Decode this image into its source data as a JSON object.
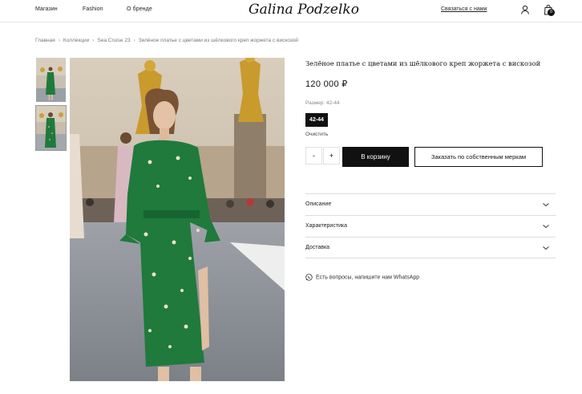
{
  "header": {
    "nav": [
      "Магазин",
      "Fashion",
      "О бренде"
    ],
    "logo": "Galina Podzelko",
    "contact": "Связаться с нами",
    "cart_count": "0",
    "icons": [
      "user-icon",
      "shopping-bag-icon"
    ]
  },
  "breadcrumb": [
    "Главная",
    "Коллекции",
    "Sea Cruise 23",
    "Зелёное платье с цветами из шёлкового креп жоржета с вискозой"
  ],
  "product": {
    "title": "Зелёное платье с цветами из шёлкового креп жоржета с вискозой",
    "price": "120 000 ₽",
    "size_label": "Размер: 42-44",
    "size_option": "42-44",
    "clear": "Очистить",
    "qty_minus": "-",
    "qty_plus": "+",
    "add_to_cart": "В корзину",
    "order_custom": "Заказать по собственным меркам"
  },
  "accordion": [
    {
      "label": "Описание"
    },
    {
      "label": "Характеристика"
    },
    {
      "label": "Доставка"
    }
  ],
  "whatsapp": "Есть вопросы, напишите нам WhatsApp",
  "colors": {
    "accent": "#111111",
    "dress_green": "#1f7a3c",
    "border": "#dcdcdc"
  }
}
